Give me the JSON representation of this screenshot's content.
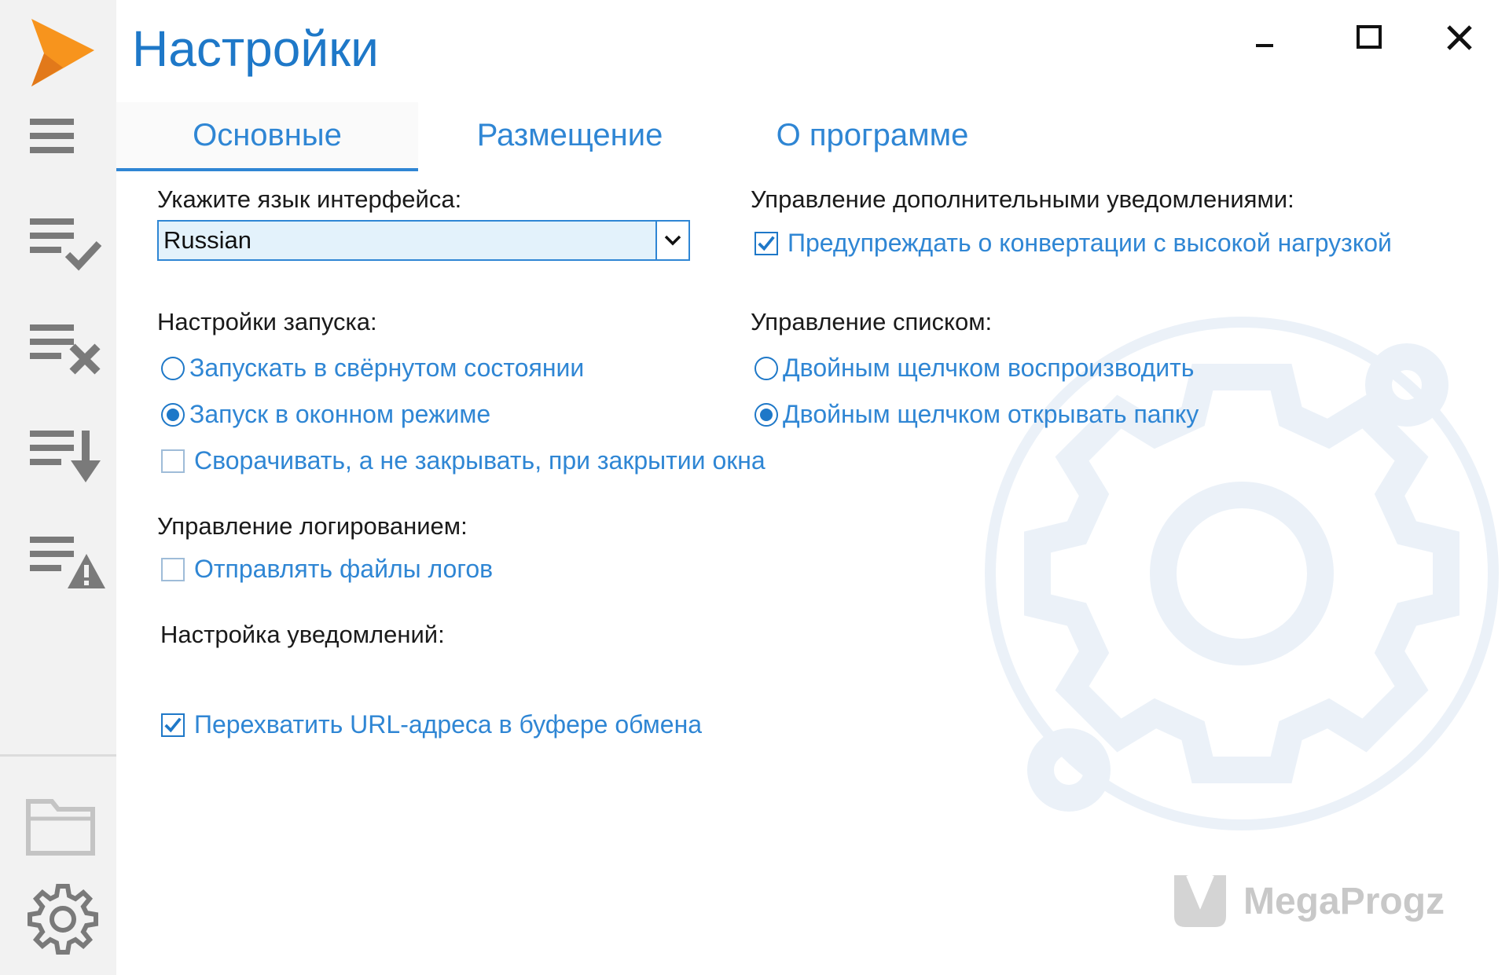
{
  "window": {
    "title": "Настройки"
  },
  "tabs": [
    {
      "label": "Основные",
      "active": true
    },
    {
      "label": "Размещение",
      "active": false
    },
    {
      "label": "О программе",
      "active": false
    }
  ],
  "sidebar": {
    "items": [
      {
        "icon": "hamburger-menu-icon"
      },
      {
        "icon": "list-check-icon"
      },
      {
        "icon": "list-remove-icon"
      },
      {
        "icon": "list-download-icon"
      },
      {
        "icon": "list-warning-icon"
      },
      {
        "icon": "folder-icon"
      },
      {
        "icon": "gear-icon"
      }
    ]
  },
  "left": {
    "language_label": "Укажите язык интерфейса:",
    "language_value": "Russian",
    "startup_label": "Настройки запуска:",
    "startup_minimized": "Запускать в свёрнутом состоянии",
    "startup_windowed": "Запуск в оконном режиме",
    "minimize_on_close": "Сворачивать, а не закрывать, при закрытии окна",
    "logging_label": "Управление логированием:",
    "send_logs": "Отправлять файлы логов",
    "notifications_label": "Настройка уведомлений:",
    "intercept_urls": "Перехватить URL-адреса в буфере обмена"
  },
  "right": {
    "extra_notifications_label": "Управление дополнительными уведомлениями:",
    "warn_high_load": "Предупреждать о конвертации с высокой нагрузкой",
    "list_label": "Управление списком:",
    "double_click_play": "Двойным щелчком воспроизводить",
    "double_click_open_folder": "Двойным щелчком открывать папку"
  },
  "state": {
    "startup_mode": "windowed",
    "minimize_on_close": false,
    "send_logs": false,
    "intercept_urls": true,
    "warn_high_load": true,
    "double_click_action": "open_folder"
  },
  "watermark": "MegaProgz",
  "colors": {
    "accent": "#2f86d4",
    "title": "#1e78c8",
    "logo": "#f7941d",
    "sidebar": "#f2f2f2"
  }
}
